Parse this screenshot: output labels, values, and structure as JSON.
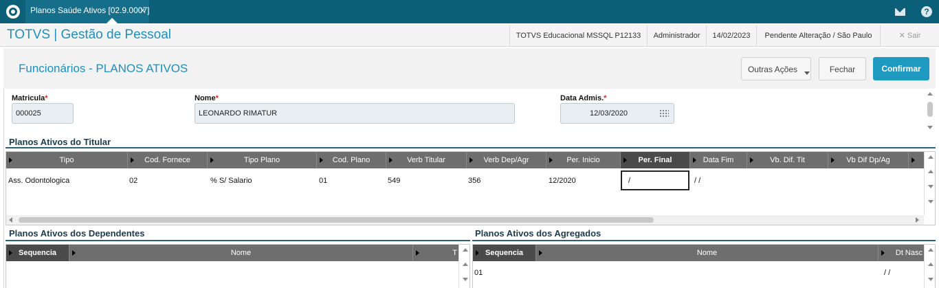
{
  "topbar": {
    "tab_label": "Planos Saúde Ativos [02.9.0007]",
    "tab_close": "×",
    "help_glyph": "?"
  },
  "header": {
    "app_title": "TOTVS | Gestão de Pessoal",
    "environment": "TOTVS Educacional MSSQL P12133",
    "user": "Administrador",
    "date": "14/02/2023",
    "status": "Pendente Alteração / São Paulo",
    "exit": "✕  Sair"
  },
  "page": {
    "title": "Funcionários - PLANOS ATIVOS",
    "buttons": {
      "outras": "Outras Ações",
      "fechar": "Fechar",
      "confirmar": "Confirmar"
    }
  },
  "form": {
    "matricula": {
      "label": "Matricula",
      "value": "000025"
    },
    "nome": {
      "label": "Nome",
      "value": "LEONARDO RIMATUR"
    },
    "data_admis": {
      "label": "Data Admis.",
      "value": "12/03/2020"
    },
    "required_mark": "*"
  },
  "titular": {
    "title": "Planos Ativos do Titular",
    "columns": [
      "Tipo",
      "Cod. Fornece",
      "Tipo Plano",
      "Cod. Plano",
      "Verb Titular",
      "Verb Dep/Agr",
      "Per. Inicio",
      "Per. Final",
      "Data Fim",
      "Vb. Dif. Tit",
      "Vb Dif Dp/Ag"
    ],
    "selected_column": "Per. Final",
    "rows": [
      [
        "Ass. Odontologica",
        "02",
        "% S/ Salario",
        "01",
        "549",
        "356",
        "12/2020",
        "/",
        "/  /",
        "",
        ""
      ]
    ]
  },
  "dependentes": {
    "title": "Planos Ativos dos Dependentes",
    "columns": [
      "Sequencia",
      "Nome",
      "T"
    ],
    "rows": []
  },
  "agregados": {
    "title": "Planos Ativos dos Agregados",
    "columns": [
      "Sequencia",
      "Nome",
      "Dt Nasc"
    ],
    "rows": [
      [
        "01",
        "",
        "/  /"
      ]
    ]
  }
}
